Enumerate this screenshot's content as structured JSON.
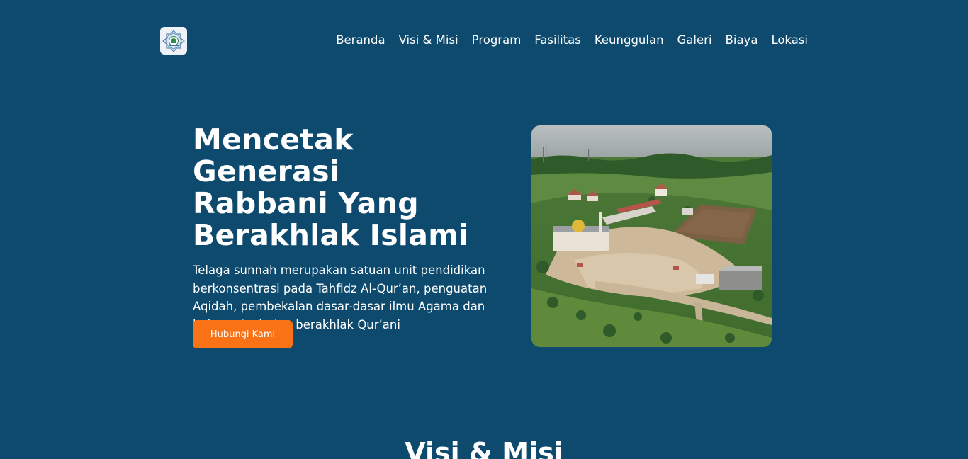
{
  "header": {
    "logo_icon": "school-emblem-icon",
    "nav": [
      {
        "label": "Beranda"
      },
      {
        "label": "Visi & Misi"
      },
      {
        "label": "Program"
      },
      {
        "label": "Fasilitas"
      },
      {
        "label": "Keunggulan"
      },
      {
        "label": "Galeri"
      },
      {
        "label": "Biaya"
      },
      {
        "label": "Lokasi"
      }
    ]
  },
  "hero": {
    "title_line1": "Mencetak Generasi",
    "title_line2": "Rabbani Yang",
    "title_line3": "Berakhlak Islami",
    "description": "Telaga sunnah merupakan satuan unit pendidikan berkonsentrasi pada Tahfidz Al-Qur’an, penguatan Aqidah, pembekalan dasar-dasar ilmu Agama dan bahasa Arab dan berakhlak Qur’ani",
    "cta_label": "Hubungi Kami"
  },
  "sections": {
    "vision_title": "Visi & Misi"
  },
  "colors": {
    "background": "#0d4a6e",
    "accent": "#f97316",
    "text": "#ffffff"
  }
}
